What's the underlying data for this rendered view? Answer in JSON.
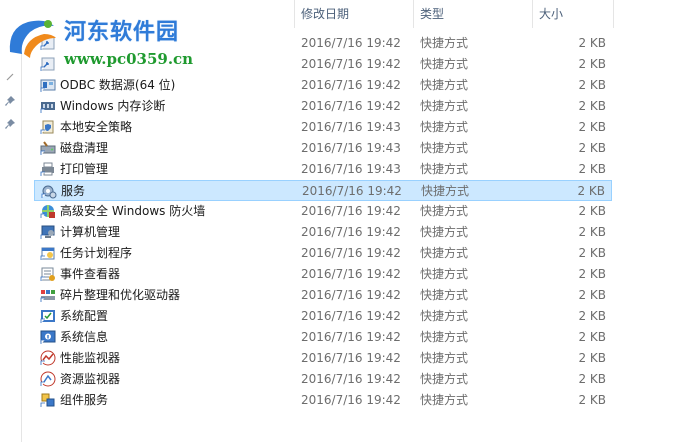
{
  "watermark": {
    "title": "河东软件园",
    "url": "www.pc0359.cn"
  },
  "columns": {
    "date": "修改日期",
    "type": "类型",
    "size": "大小"
  },
  "files": [
    {
      "name": "",
      "date": "2016/7/16 19:42",
      "type": "快捷方式",
      "size": "2 KB",
      "icon": "shortcut-icon"
    },
    {
      "name": "",
      "date": "2016/7/16 19:42",
      "type": "快捷方式",
      "size": "2 KB",
      "icon": "shortcut-icon"
    },
    {
      "name": "ODBC 数据源(64 位)",
      "date": "2016/7/16 19:42",
      "type": "快捷方式",
      "size": "2 KB",
      "icon": "odbc-icon"
    },
    {
      "name": "Windows 内存诊断",
      "date": "2016/7/16 19:42",
      "type": "快捷方式",
      "size": "2 KB",
      "icon": "memory-diagnostic-icon"
    },
    {
      "name": "本地安全策略",
      "date": "2016/7/16 19:43",
      "type": "快捷方式",
      "size": "2 KB",
      "icon": "security-policy-icon"
    },
    {
      "name": "磁盘清理",
      "date": "2016/7/16 19:43",
      "type": "快捷方式",
      "size": "2 KB",
      "icon": "disk-cleanup-icon"
    },
    {
      "name": "打印管理",
      "date": "2016/7/16 19:43",
      "type": "快捷方式",
      "size": "2 KB",
      "icon": "print-management-icon"
    },
    {
      "name": "服务",
      "date": "2016/7/16 19:42",
      "type": "快捷方式",
      "size": "2 KB",
      "icon": "services-icon",
      "selected": true
    },
    {
      "name": "高级安全 Windows 防火墙",
      "date": "2016/7/16 19:42",
      "type": "快捷方式",
      "size": "2 KB",
      "icon": "firewall-icon"
    },
    {
      "name": "计算机管理",
      "date": "2016/7/16 19:42",
      "type": "快捷方式",
      "size": "2 KB",
      "icon": "computer-management-icon"
    },
    {
      "name": "任务计划程序",
      "date": "2016/7/16 19:42",
      "type": "快捷方式",
      "size": "2 KB",
      "icon": "task-scheduler-icon"
    },
    {
      "name": "事件查看器",
      "date": "2016/7/16 19:42",
      "type": "快捷方式",
      "size": "2 KB",
      "icon": "event-viewer-icon"
    },
    {
      "name": "碎片整理和优化驱动器",
      "date": "2016/7/16 19:42",
      "type": "快捷方式",
      "size": "2 KB",
      "icon": "defrag-icon"
    },
    {
      "name": "系统配置",
      "date": "2016/7/16 19:42",
      "type": "快捷方式",
      "size": "2 KB",
      "icon": "system-config-icon"
    },
    {
      "name": "系统信息",
      "date": "2016/7/16 19:42",
      "type": "快捷方式",
      "size": "2 KB",
      "icon": "system-info-icon"
    },
    {
      "name": "性能监视器",
      "date": "2016/7/16 19:42",
      "type": "快捷方式",
      "size": "2 KB",
      "icon": "performance-monitor-icon"
    },
    {
      "name": "资源监视器",
      "date": "2016/7/16 19:42",
      "type": "快捷方式",
      "size": "2 KB",
      "icon": "resource-monitor-icon"
    },
    {
      "name": "组件服务",
      "date": "2016/7/16 19:42",
      "type": "快捷方式",
      "size": "2 KB",
      "icon": "component-services-icon"
    }
  ],
  "colors": {
    "selected_bg": "#cce8ff",
    "selected_border": "#99d1ff",
    "header_text": "#4c607a",
    "secondary_text": "#6d6d6d"
  }
}
